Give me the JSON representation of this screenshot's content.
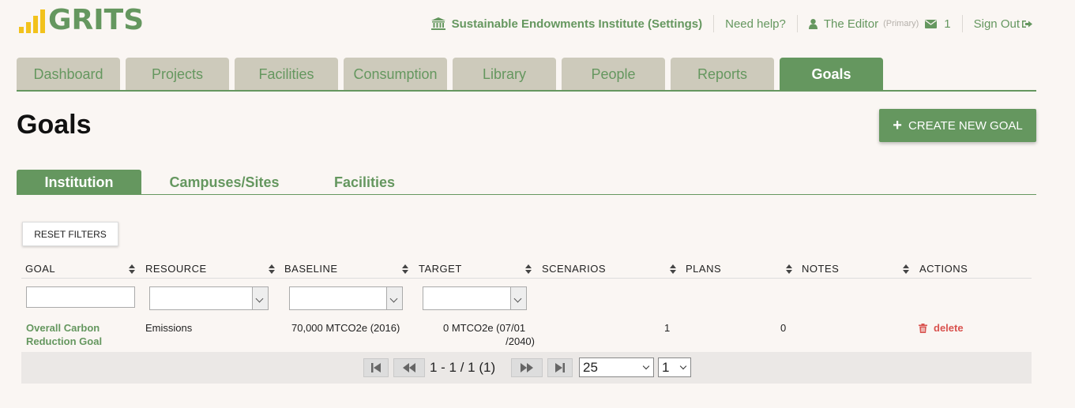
{
  "brand": {
    "name": "GRITS",
    "accent": "#65975f",
    "bar_color": "#f2c21c"
  },
  "topnav": {
    "institution": "Sustainable Endowments Institute (Settings)",
    "help": "Need help?",
    "user": "The Editor",
    "user_role": "(Primary)",
    "messages_count": "1",
    "sign_out": "Sign Out"
  },
  "main_tabs": [
    "Dashboard",
    "Projects",
    "Facilities",
    "Consumption",
    "Library",
    "People",
    "Reports",
    "Goals"
  ],
  "active_main_tab": "Goals",
  "page": {
    "title": "Goals",
    "create_button": "CREATE NEW GOAL"
  },
  "sub_tabs": [
    "Institution",
    "Campuses/Sites",
    "Facilities"
  ],
  "active_sub_tab": "Institution",
  "reset_filters": "RESET FILTERS",
  "table": {
    "columns": [
      "GOAL",
      "RESOURCE",
      "BASELINE",
      "TARGET",
      "SCENARIOS",
      "PLANS",
      "NOTES",
      "ACTIONS"
    ],
    "rows": [
      {
        "goal_line1": "Overall Carbon",
        "goal_line2": "Reduction Goal",
        "resource": "Emissions",
        "baseline": "70,000 MTCO2e (2016)",
        "target_line1": "0 MTCO2e (07/01",
        "target_line2": "/2040)",
        "scenarios": "1",
        "plans": "0",
        "notes": "",
        "action": "delete"
      }
    ]
  },
  "pager": {
    "info": "1 - 1 / 1 (1)",
    "page_size": "25",
    "page": "1"
  }
}
